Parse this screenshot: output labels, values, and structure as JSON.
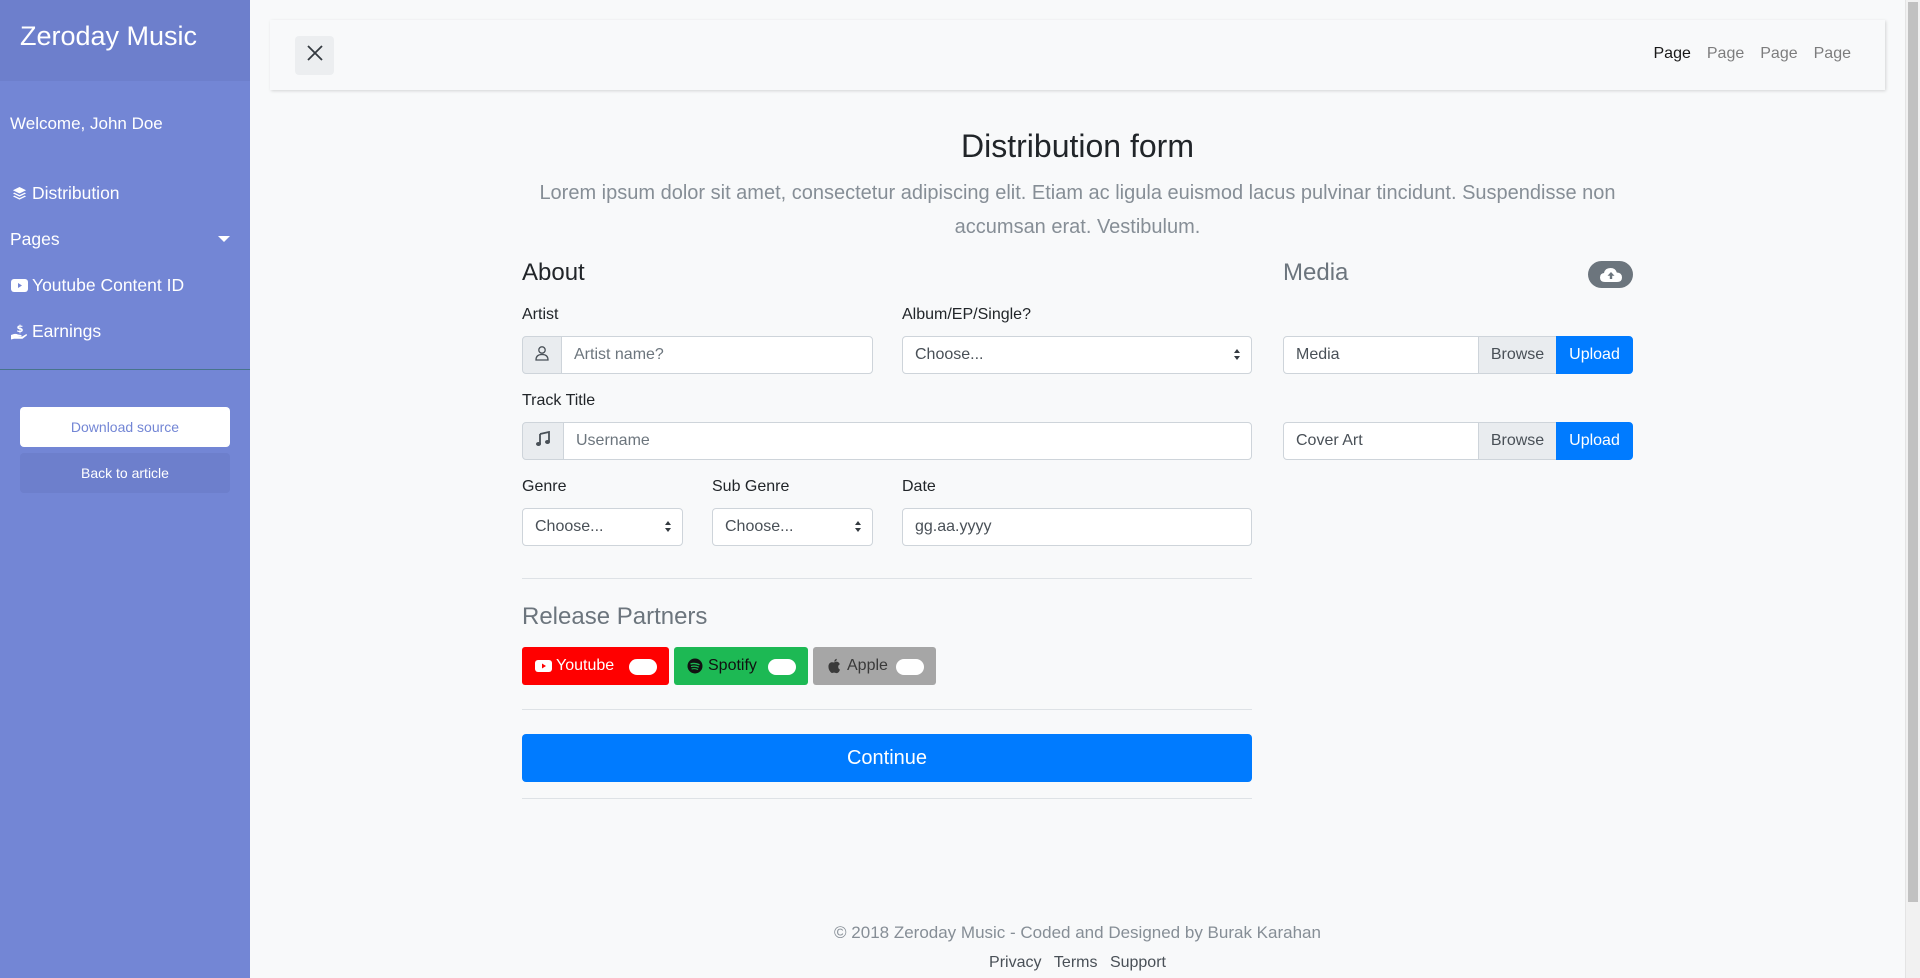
{
  "sidebar": {
    "title": "Zeroday Music",
    "welcome": "Welcome, John Doe",
    "items": [
      {
        "label": "Distribution",
        "icon": "layers-icon"
      },
      {
        "label": "Pages",
        "icon": "none"
      },
      {
        "label": "Youtube Content ID",
        "icon": "youtube-icon"
      },
      {
        "label": "Earnings",
        "icon": "hand-holding-usd-icon"
      }
    ],
    "download_label": "Download source",
    "back_label": "Back to article"
  },
  "topbar": {
    "links": [
      "Page",
      "Page",
      "Page",
      "Page"
    ]
  },
  "main": {
    "title": "Distribution form",
    "lead": "Lorem ipsum dolor sit amet, consectetur adipiscing elit. Etiam ac ligula euismod lacus pulvinar tincidunt. Suspendisse non accumsan erat. Vestibulum.",
    "about": {
      "heading": "About",
      "artist_label": "Artist",
      "artist_placeholder": "Artist name?",
      "album_label": "Album/EP/Single?",
      "album_value": "Choose...",
      "track_label": "Track Title",
      "track_placeholder": "Username",
      "genre_label": "Genre",
      "genre_value": "Choose...",
      "subgenre_label": "Sub Genre",
      "subgenre_value": "Choose...",
      "date_label": "Date",
      "date_value": "gg.aa.yyyy"
    },
    "partners": {
      "heading": "Release Partners",
      "items": [
        {
          "label": "Youtube",
          "color": "#ff0000"
        },
        {
          "label": "Spotify",
          "color": "#1db954"
        },
        {
          "label": "Apple",
          "color": "#a6a6a6"
        }
      ]
    },
    "continue_label": "Continue",
    "media": {
      "heading": "Media",
      "rows": [
        {
          "value": "Media",
          "browse": "Browse",
          "upload": "Upload"
        },
        {
          "value": "Cover Art",
          "browse": "Browse",
          "upload": "Upload"
        }
      ]
    }
  },
  "footer": {
    "copyright": "© 2018 Zeroday Music - Coded and Designed by Burak Karahan",
    "links": [
      "Privacy",
      "Terms",
      "Support"
    ]
  },
  "colors": {
    "sidebar": "#7386d5",
    "sidebar_header": "#6d7fcc",
    "primary": "#007bff"
  }
}
